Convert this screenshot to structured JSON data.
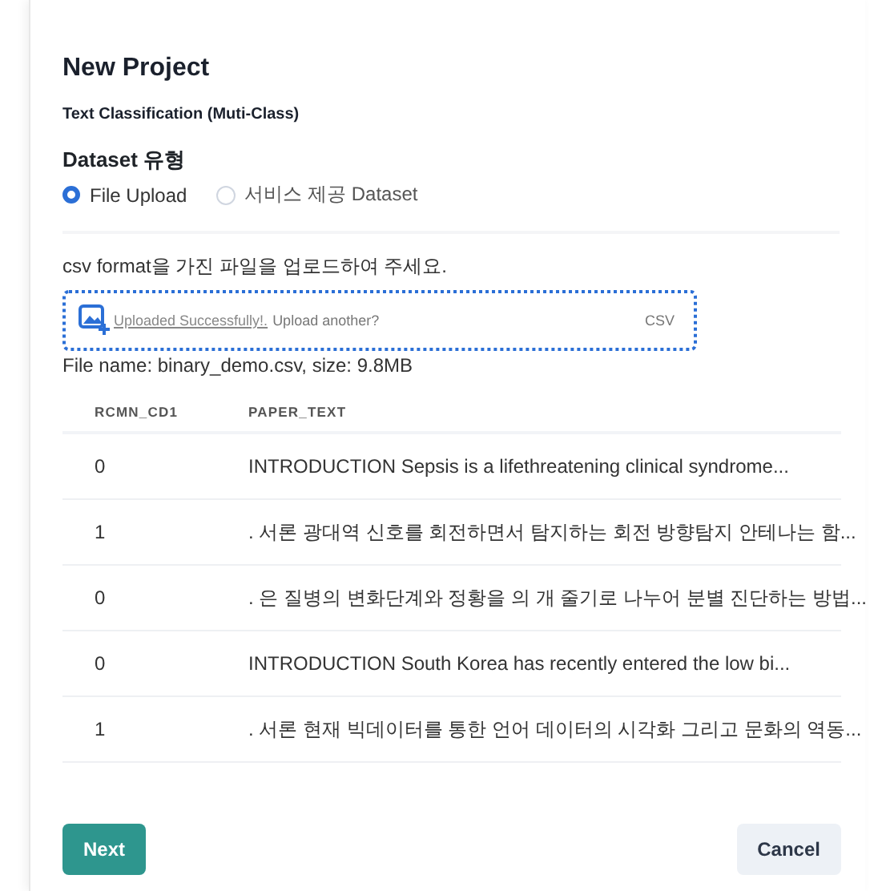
{
  "dialog": {
    "title": "New Project",
    "subtitle": "Text Classification (Muti-Class)"
  },
  "dataset_type": {
    "label": "Dataset 유형",
    "options": [
      {
        "label": "File Upload",
        "selected": true
      },
      {
        "label": "서비스 제공 Dataset",
        "selected": false
      }
    ]
  },
  "upload": {
    "instruction": "csv format을 가진 파일을 업로드하여 주세요.",
    "status_link": "Uploaded Successfully!.",
    "prompt": "Upload another?",
    "format": "CSV",
    "file_info": "File name: binary_demo.csv, size: 9.8MB"
  },
  "table": {
    "columns": [
      "RCMN_CD1",
      "PAPER_TEXT"
    ],
    "rows": [
      [
        "0",
        "INTRODUCTION Sepsis is a lifethreatening clinical syndrome..."
      ],
      [
        "1",
        ". 서론 광대역 신호를 회전하면서 탐지하는 회전 방향탐지 안테나는 함..."
      ],
      [
        "0",
        ". 은 질병의 변화단계와 정황을 의 개 줄기로 나누어 분별 진단하는 방법..."
      ],
      [
        "0",
        "INTRODUCTION South Korea has recently entered the low bi..."
      ],
      [
        "1",
        ". 서론 현재 빅데이터를 통한 언어 데이터의 시각화 그리고 문화의 역동..."
      ]
    ]
  },
  "buttons": [
    {
      "label": "Next",
      "kind": "primary"
    },
    {
      "label": "Cancel",
      "kind": "secondary"
    }
  ]
}
